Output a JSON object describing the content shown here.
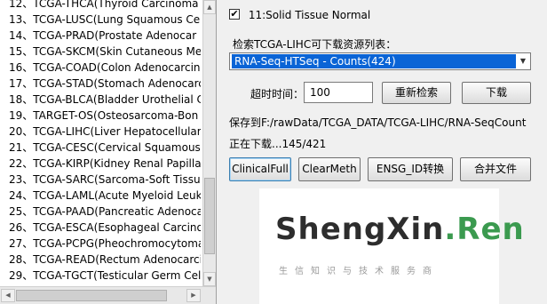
{
  "project_list": {
    "items": [
      "12、TCGA-THCA(Thyroid Carcinoma",
      "13、TCGA-LUSC(Lung Squamous Ce",
      "14、TCGA-PRAD(Prostate Adenocar",
      "15、TCGA-SKCM(Skin Cutaneous Me",
      "16、TCGA-COAD(Colon Adenocarcin",
      "17、TCGA-STAD(Stomach Adenocarc",
      "18、TCGA-BLCA(Bladder Urothelial C",
      "19、TARGET-OS(Osteosarcoma-Bon",
      "20、TCGA-LIHC(Liver Hepatocellular",
      "21、TCGA-CESC(Cervical Squamous",
      "22、TCGA-KIRP(Kidney Renal Papilla",
      "23、TCGA-SARC(Sarcoma-Soft Tissu",
      "24、TCGA-LAML(Acute Myeloid Leuk",
      "25、TCGA-PAAD(Pancreatic Adenoca",
      "26、TCGA-ESCA(Esophageal Carcino",
      "27、TCGA-PCPG(Pheochromocytoma",
      "28、TCGA-READ(Rectum Adenocarci",
      "29、TCGA-TGCT(Testicular Germ Cel"
    ]
  },
  "sample_type": {
    "checked": true,
    "check_mark": "✔",
    "label": "11:Solid Tissue Normal"
  },
  "resource": {
    "label": "检索TCGA-LIHC可下载资源列表：",
    "selected": "RNA-Seq-HTSeq - Counts(424)"
  },
  "timeout": {
    "label": "超时时间：",
    "value": "100"
  },
  "buttons": {
    "research": "重新检索",
    "download": "下载",
    "clinical_full": "ClinicalFull",
    "clear_meth": "ClearMeth",
    "ensg_convert": "ENSG_ID转换",
    "merge_files": "合并文件"
  },
  "status": {
    "save_path": "保存到F:/rawData/TCGA_DATA/TCGA-LIHC/RNA-SeqCount",
    "progress": "正在下载...145/421"
  },
  "banner": {
    "logo_main": "ShengXin",
    "logo_dot": ".",
    "logo_suffix": "Ren",
    "tagline": "生信知识与技术服务商",
    "colors": {
      "dark": "#2d2d2d",
      "green": "#3b9a4f"
    }
  }
}
